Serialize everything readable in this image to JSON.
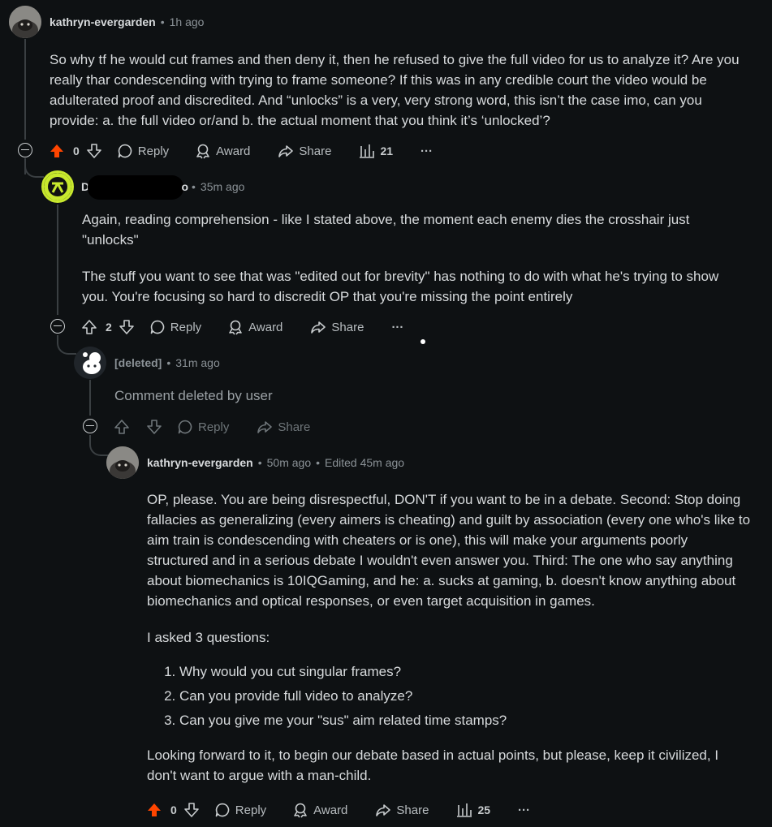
{
  "comment1": {
    "author": "kathryn-evergarden",
    "sep": "•",
    "time": "1h ago",
    "body": "So why tf he would cut frames and then deny it, then he refused to give the full video for us to analyze it? Are you really thar condescending with trying to frame someone? If this was in any credible court the video would be adulterated proof and discredited. And “unlocks” is a very, very strong word, this isn’t the case imo, can you provide: a. the full video or/and b. the actual moment that you think it’s ‘unlocked’?",
    "votes": "0",
    "reply": "Reply",
    "award": "Award",
    "share": "Share",
    "views": "21",
    "more": "···"
  },
  "comment2": {
    "author_visible": "D",
    "author_tail": "o",
    "sep": "•",
    "time": "35m ago",
    "para1": "Again, reading comprehension - like I stated above, the moment each enemy dies the crosshair just \"unlocks\"",
    "para2": "The stuff you want to see that was \"edited out for brevity\" has nothing to do with what he's trying to show you. You're focusing so hard to discredit OP that you're missing the point entirely",
    "votes": "2",
    "reply": "Reply",
    "award": "Award",
    "share": "Share",
    "more": "···"
  },
  "comment3": {
    "author": "[deleted]",
    "sep": "•",
    "time": "31m ago",
    "body": "Comment deleted by user",
    "reply": "Reply",
    "share": "Share"
  },
  "comment4": {
    "author": "kathryn-evergarden",
    "sep": "•",
    "time": "50m ago",
    "sep2": "•",
    "edited": "Edited 45m ago",
    "para1": "OP, please. You are being disrespectful, DON'T if you want to be in a debate. Second: Stop doing fallacies as generalizing (every aimers is cheating) and guilt by association (every one who's like to aim train is condescending with cheaters or is one), this will make your arguments poorly structured and in a serious debate I wouldn't even answer you. Third: The one who say anything about biomechanics is 10IQGaming, and he: a. sucks at gaming, b. doesn't know anything about biomechanics and optical responses, or even target acquisition in games.",
    "para2": "I asked 3 questions:",
    "questions": [
      "Why would you cut singular frames?",
      "Can you provide full video to analyze?",
      "Can you give me your \"sus\" aim related time stamps?"
    ],
    "para3": "Looking forward to it, to begin our debate based in actual points, but please, keep it civilized, I don't want to argue with a man-child.",
    "votes": "0",
    "reply": "Reply",
    "award": "Award",
    "share": "Share",
    "views": "25",
    "more": "···"
  },
  "colors": {
    "background": "#0e1113",
    "upvote_active": "#ff4500",
    "avatar_green": "#c8e82e",
    "text": "#d7dadc",
    "meta": "#8a9196"
  }
}
